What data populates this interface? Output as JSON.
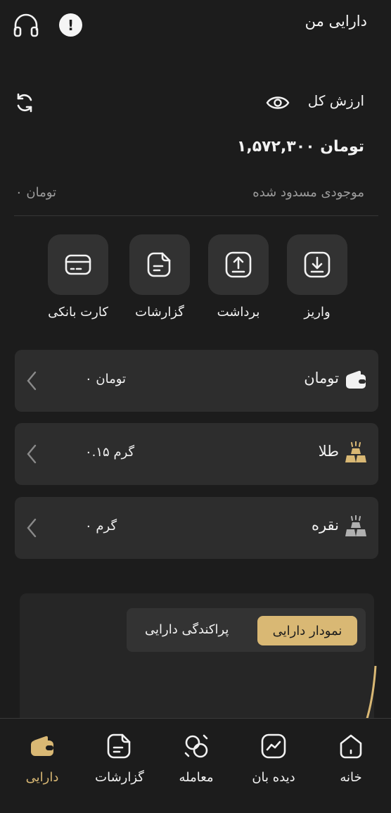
{
  "header": {
    "title": "دارایی من"
  },
  "balance": {
    "total_label": "ارزش کل",
    "total_value": "۱,۵۷۲,۳۰۰ تومان",
    "blocked_label": "موجودی مسدود شده",
    "blocked_value": "۰ تومان"
  },
  "actions": [
    {
      "label": "واریز",
      "icon": "download-icon"
    },
    {
      "label": "برداشت",
      "icon": "upload-icon"
    },
    {
      "label": "گزارشات",
      "icon": "document-icon"
    },
    {
      "label": "کارت بانکی",
      "icon": "card-icon"
    }
  ],
  "assets": [
    {
      "name": "تومان",
      "value": "۰ تومان",
      "icon": "wallet-icon"
    },
    {
      "name": "طلا",
      "value": "۰.۱۵ گرم",
      "icon": "gold-bars-icon"
    },
    {
      "name": "نقره",
      "value": "۰ گرم",
      "icon": "silver-bars-icon"
    }
  ],
  "chart_tabs": {
    "active": "نمودار دارایی",
    "other": "پراکندگی دارایی"
  },
  "nav": [
    {
      "label": "خانه",
      "icon": "home-icon"
    },
    {
      "label": "دیده بان",
      "icon": "chart-line-icon"
    },
    {
      "label": "معامله",
      "icon": "trade-icon"
    },
    {
      "label": "گزارشات",
      "icon": "document-icon"
    },
    {
      "label": "دارایی",
      "icon": "wallet-icon",
      "active": true
    }
  ],
  "colors": {
    "background": "#1c1c1c",
    "card": "#2d2d2d",
    "accent": "#d9b874",
    "gold": "#d9b874",
    "silver": "#b0b0b0"
  }
}
